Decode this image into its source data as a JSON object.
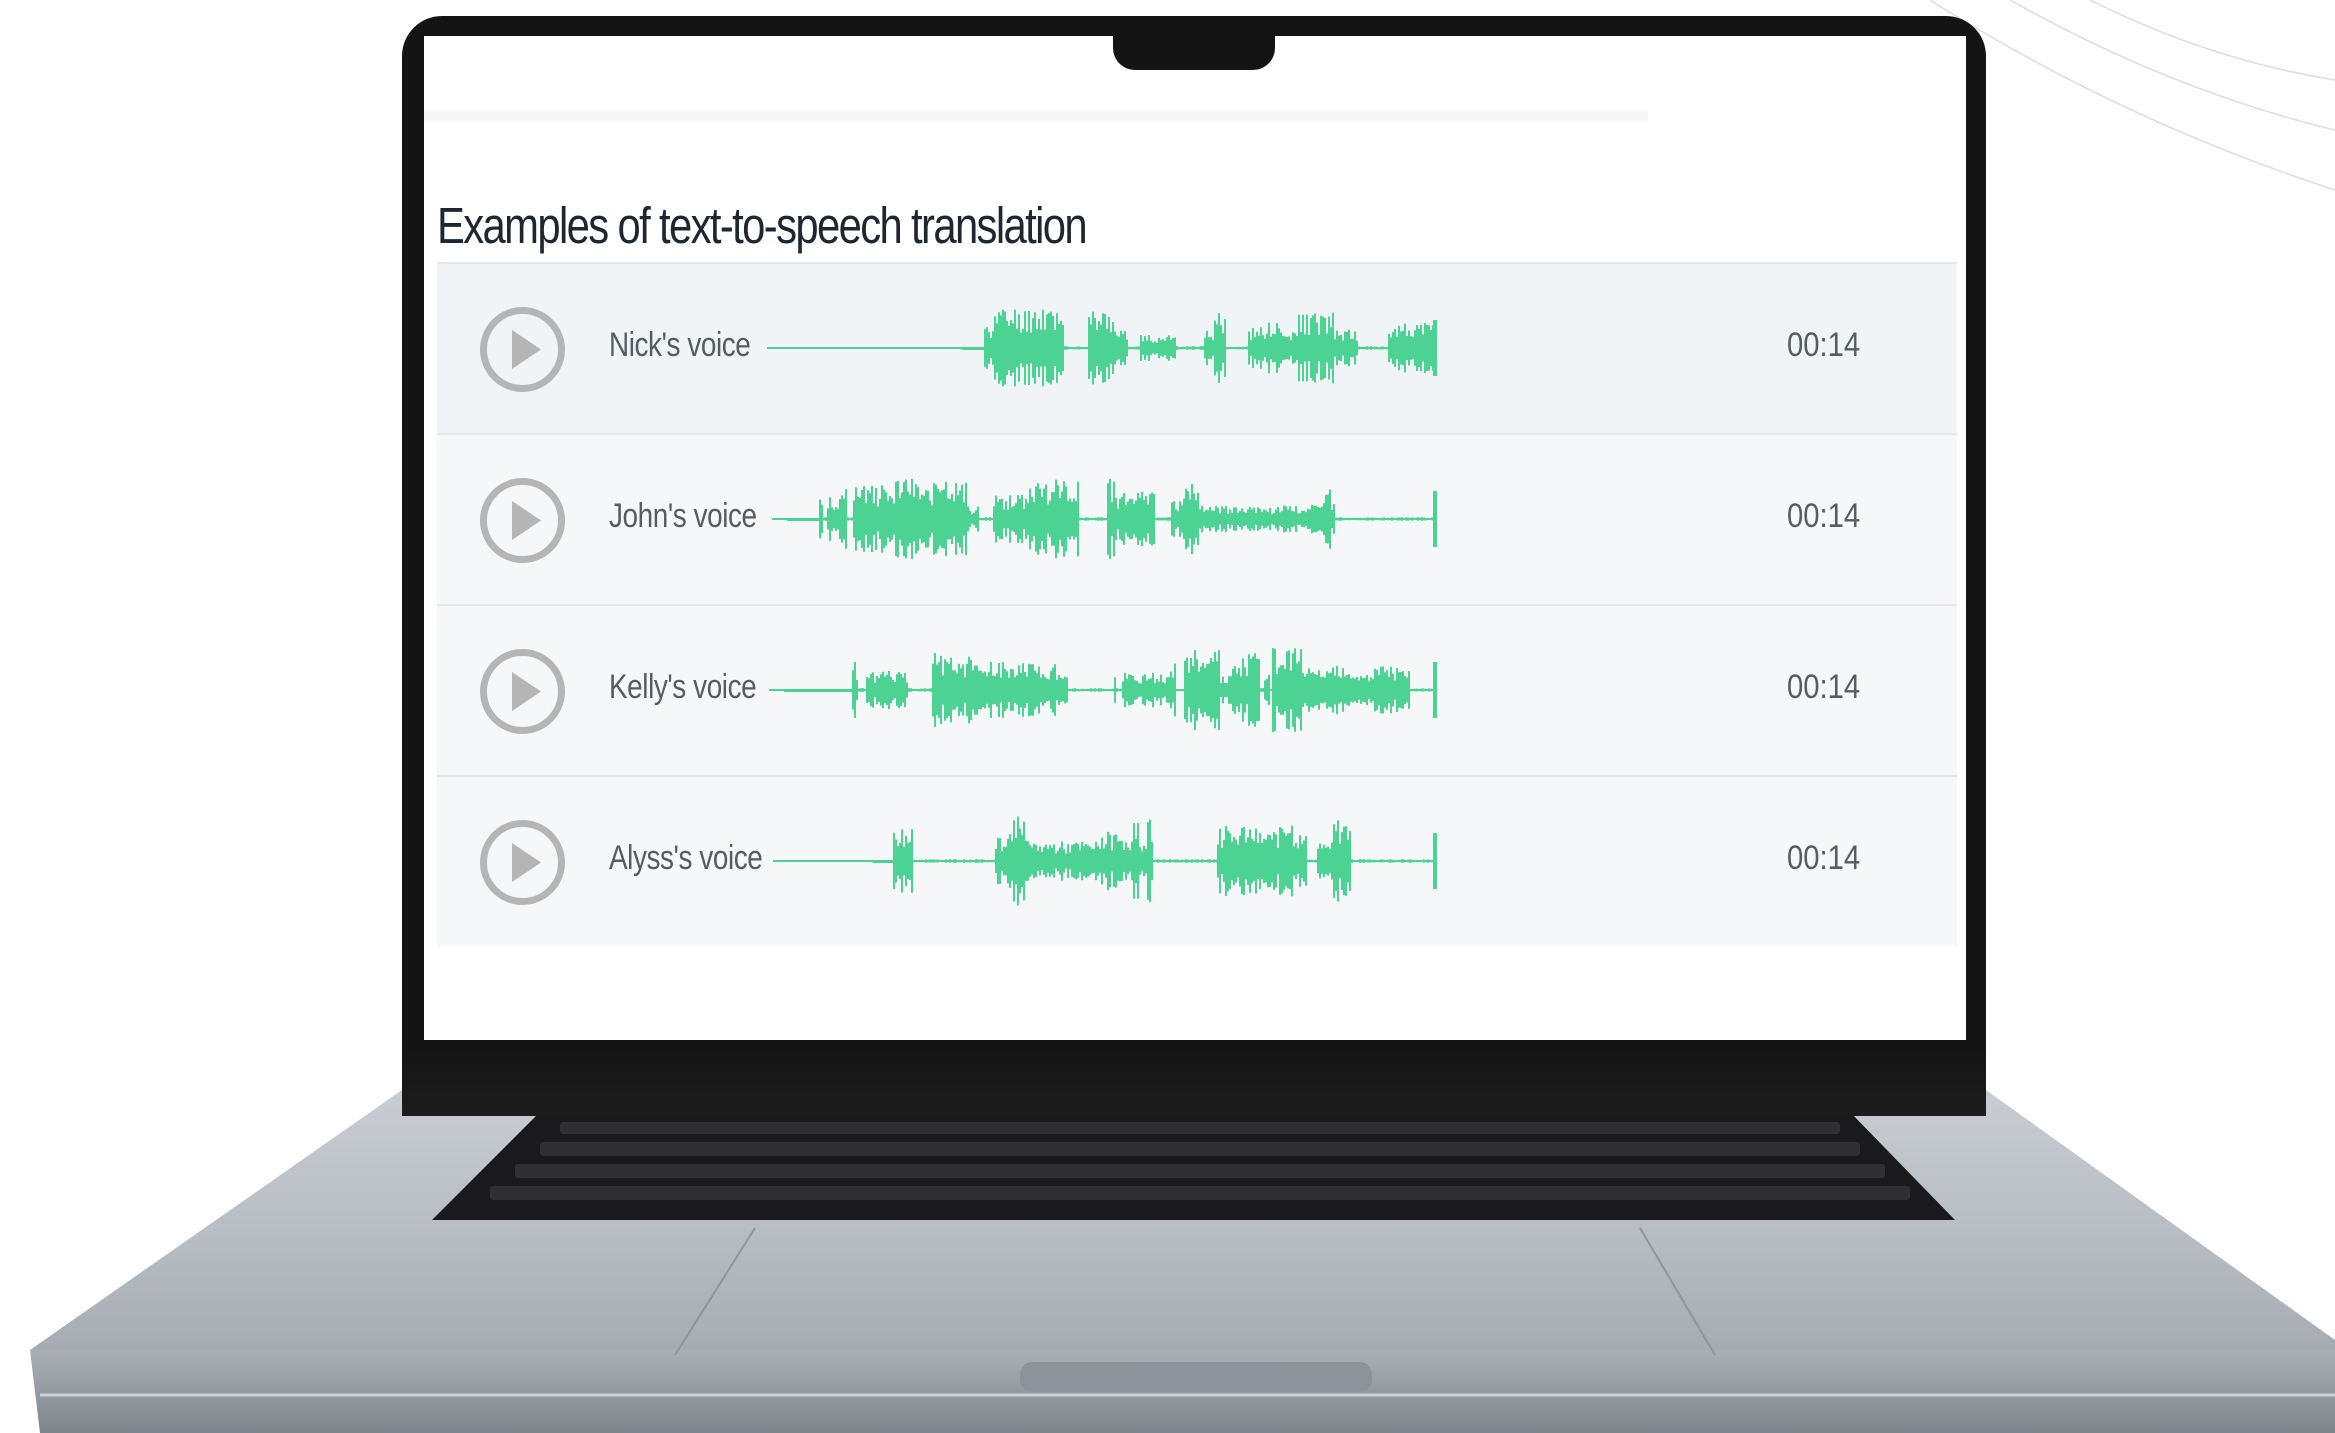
{
  "page": {
    "title": "Examples of text-to-speech translation"
  },
  "colors": {
    "waveform": "#4cd394",
    "play_icon": "#b5b5b5",
    "text": "#575c63",
    "heading": "#1e2630"
  },
  "tracks": [
    {
      "label": "Nick's voice",
      "duration": "00:14",
      "icon": "play-icon"
    },
    {
      "label": "John's voice",
      "duration": "00:14",
      "icon": "play-icon"
    },
    {
      "label": "Kelly's voice",
      "duration": "00:14",
      "icon": "play-icon"
    },
    {
      "label": "Alyss's voice",
      "duration": "00:14",
      "icon": "play-icon"
    }
  ]
}
